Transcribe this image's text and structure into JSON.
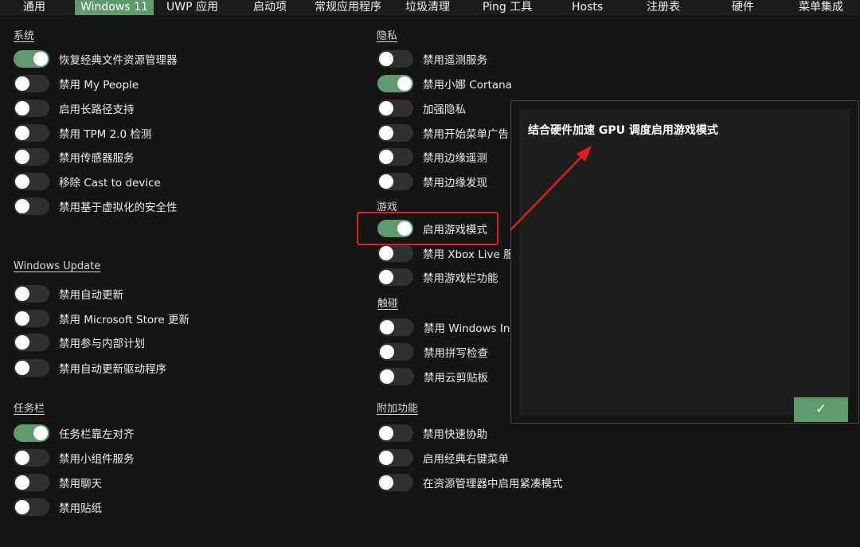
{
  "tabs": [
    {
      "label": "通用"
    },
    {
      "label": "Windows 11"
    },
    {
      "label": "UWP 应用"
    },
    {
      "label": "启动项"
    },
    {
      "label": "常规应用程序"
    },
    {
      "label": "垃圾清理"
    },
    {
      "label": "Ping 工具"
    },
    {
      "label": "Hosts"
    },
    {
      "label": "注册表"
    },
    {
      "label": "硬件"
    },
    {
      "label": "菜单集成"
    }
  ],
  "active_tab": "Windows 11",
  "sections": {
    "system": {
      "title": "系统",
      "items": [
        {
          "label": "恢复经典文件资源管理器",
          "on": true
        },
        {
          "label": "禁用 My People",
          "on": false
        },
        {
          "label": "启用长路径支持",
          "on": false
        },
        {
          "label": "禁用 TPM 2.0 检测",
          "on": false
        },
        {
          "label": "禁用传感器服务",
          "on": false
        },
        {
          "label": "移除 Cast to device",
          "on": false
        },
        {
          "label": "禁用基于虚拟化的安全性",
          "on": false
        }
      ]
    },
    "windows_update": {
      "title": "Windows Update",
      "items": [
        {
          "label": "禁用自动更新",
          "on": false
        },
        {
          "label": "禁用 Microsoft Store 更新",
          "on": false
        },
        {
          "label": "禁用参与内部计划",
          "on": false
        },
        {
          "label": "禁用自动更新驱动程序",
          "on": false
        }
      ]
    },
    "taskbar": {
      "title": "任务栏",
      "items": [
        {
          "label": "任务栏靠左对齐",
          "on": true
        },
        {
          "label": "禁用小组件服务",
          "on": false
        },
        {
          "label": "禁用聊天",
          "on": false
        },
        {
          "label": "禁用贴纸",
          "on": false
        }
      ]
    },
    "privacy": {
      "title": "隐私",
      "items": [
        {
          "label": "禁用遥测服务",
          "on": false
        },
        {
          "label": "禁用小娜 Cortana",
          "on": true
        },
        {
          "label": "加强隐私",
          "on": false
        },
        {
          "label": "禁用开始菜单广告",
          "on": false
        },
        {
          "label": "禁用边缘遥测",
          "on": false
        },
        {
          "label": "禁用边缘发现",
          "on": false
        }
      ]
    },
    "gaming": {
      "title": "游戏",
      "items": [
        {
          "label": "启用游戏模式",
          "on": true
        },
        {
          "label": "禁用 Xbox Live 服",
          "on": false
        },
        {
          "label": "禁用游戏栏功能",
          "on": false
        }
      ]
    },
    "touch": {
      "title": "触碰",
      "items": [
        {
          "label": "禁用 Windows Ink",
          "on": false
        },
        {
          "label": "禁用拼写检查",
          "on": false
        },
        {
          "label": "禁用云剪贴板",
          "on": false
        }
      ]
    },
    "addons": {
      "title": "附加功能",
      "items": [
        {
          "label": "禁用快速协助",
          "on": false
        },
        {
          "label": "启用经典右键菜单",
          "on": false
        },
        {
          "label": "在资源管理器中启用紧凑模式",
          "on": false
        }
      ]
    }
  },
  "popup": {
    "text": "结合硬件加速 GPU 调度启用游戏模式",
    "ok_label": "✓"
  },
  "colors": {
    "accent": "#5f9a6c",
    "background": "#151515",
    "toggle_off": "#303030",
    "highlight": "#e0201c"
  }
}
